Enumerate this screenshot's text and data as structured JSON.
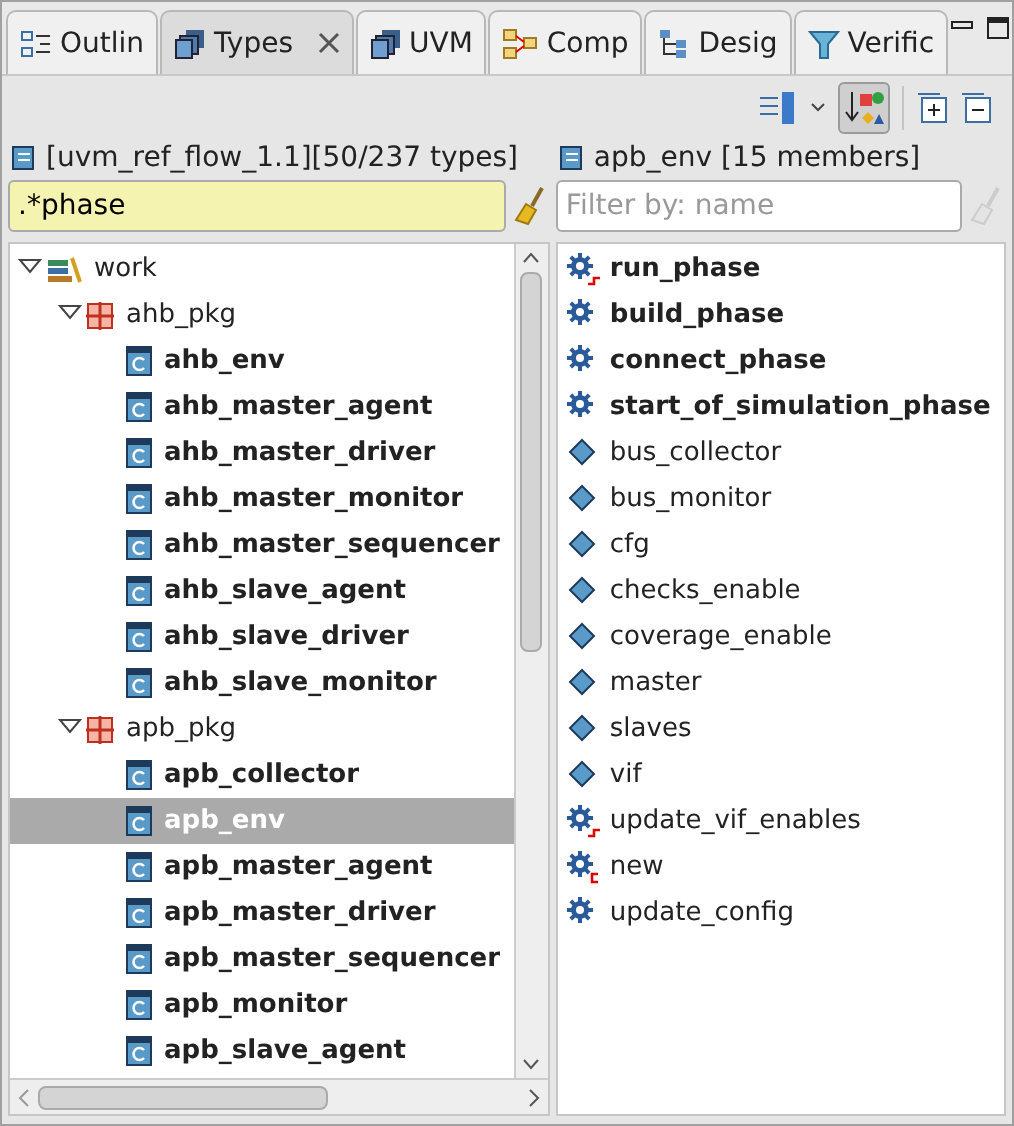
{
  "tabs": [
    {
      "label": "Outlin",
      "kind": "outline",
      "selected": false,
      "closable": false
    },
    {
      "label": "Types",
      "kind": "types",
      "selected": true,
      "closable": true
    },
    {
      "label": "UVM",
      "kind": "types",
      "selected": false,
      "closable": false
    },
    {
      "label": "Comp",
      "kind": "comp",
      "selected": false,
      "closable": false
    },
    {
      "label": "Desig",
      "kind": "design",
      "selected": false,
      "closable": false
    },
    {
      "label": "Verific",
      "kind": "verif",
      "selected": false,
      "closable": false
    }
  ],
  "toolbar": {
    "sort_toggle_on": true
  },
  "types_pane": {
    "header": "[uvm_ref_flow_1.1][50/237 types]",
    "filter": {
      "value": ".*phase",
      "highlighted": true
    },
    "tree": [
      {
        "label": "work",
        "kind": "library",
        "expanded": true,
        "selected": false,
        "children": [
          {
            "label": "ahb_pkg",
            "kind": "package",
            "expanded": true,
            "selected": false,
            "children": [
              {
                "label": "ahb_env",
                "kind": "class",
                "selected": false
              },
              {
                "label": "ahb_master_agent",
                "kind": "class",
                "selected": false
              },
              {
                "label": "ahb_master_driver",
                "kind": "class",
                "selected": false
              },
              {
                "label": "ahb_master_monitor",
                "kind": "class",
                "selected": false
              },
              {
                "label": "ahb_master_sequencer",
                "kind": "class",
                "selected": false
              },
              {
                "label": "ahb_slave_agent",
                "kind": "class",
                "selected": false
              },
              {
                "label": "ahb_slave_driver",
                "kind": "class",
                "selected": false
              },
              {
                "label": "ahb_slave_monitor",
                "kind": "class",
                "selected": false
              }
            ]
          },
          {
            "label": "apb_pkg",
            "kind": "package",
            "expanded": true,
            "selected": false,
            "children": [
              {
                "label": "apb_collector",
                "kind": "class",
                "selected": false
              },
              {
                "label": "apb_env",
                "kind": "class",
                "selected": true
              },
              {
                "label": "apb_master_agent",
                "kind": "class",
                "selected": false
              },
              {
                "label": "apb_master_driver",
                "kind": "class",
                "selected": false
              },
              {
                "label": "apb_master_sequencer",
                "kind": "class",
                "selected": false
              },
              {
                "label": "apb_monitor",
                "kind": "class",
                "selected": false
              },
              {
                "label": "apb_slave_agent",
                "kind": "class",
                "selected": false
              }
            ]
          }
        ]
      }
    ]
  },
  "members_pane": {
    "header": "apb_env [15 members]",
    "filter": {
      "placeholder": "Filter by: name",
      "highlighted": false
    },
    "members": [
      {
        "label": "run_phase",
        "kind": "override",
        "bold": true
      },
      {
        "label": "build_phase",
        "kind": "method",
        "bold": true
      },
      {
        "label": "connect_phase",
        "kind": "method",
        "bold": true
      },
      {
        "label": "start_of_simulation_phase",
        "kind": "method",
        "bold": true
      },
      {
        "label": "bus_collector",
        "kind": "field",
        "bold": false
      },
      {
        "label": "bus_monitor",
        "kind": "field",
        "bold": false
      },
      {
        "label": "cfg",
        "kind": "field",
        "bold": false
      },
      {
        "label": "checks_enable",
        "kind": "field",
        "bold": false
      },
      {
        "label": "coverage_enable",
        "kind": "field",
        "bold": false
      },
      {
        "label": "master",
        "kind": "field",
        "bold": false
      },
      {
        "label": "slaves",
        "kind": "field",
        "bold": false
      },
      {
        "label": "vif",
        "kind": "field",
        "bold": false
      },
      {
        "label": "update_vif_enables",
        "kind": "override",
        "bold": false
      },
      {
        "label": "new",
        "kind": "constructor",
        "bold": false
      },
      {
        "label": "update_config",
        "kind": "method",
        "bold": false
      }
    ]
  }
}
